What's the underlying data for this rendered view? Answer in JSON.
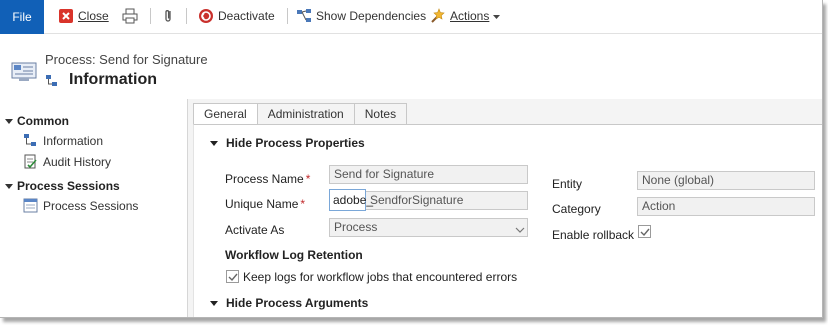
{
  "ribbon": {
    "file_label": "File",
    "close_label": "Close",
    "deactivate_label": "Deactivate",
    "show_dependencies_label": "Show Dependencies",
    "actions_label": "Actions"
  },
  "header": {
    "process_title": "Process: Send for Signature",
    "form_title": "Information"
  },
  "nav": {
    "common_label": "Common",
    "common_items": [
      {
        "label": "Information",
        "icon": "information-icon"
      },
      {
        "label": "Audit History",
        "icon": "audit-history-icon"
      }
    ],
    "process_sessions_label": "Process Sessions",
    "process_sessions_items": [
      {
        "label": "Process Sessions",
        "icon": "process-sessions-icon"
      }
    ]
  },
  "tabs": [
    {
      "label": "General",
      "active": true
    },
    {
      "label": "Administration",
      "active": false
    },
    {
      "label": "Notes",
      "active": false
    }
  ],
  "form": {
    "hide_properties_label": "Hide Process Properties",
    "process_name_label": "Process Name",
    "process_name_value": "Send for Signature",
    "unique_name_label": "Unique Name",
    "unique_name_prefix": "adobe_",
    "unique_name_value": "SendforSignature",
    "activate_as_label": "Activate As",
    "activate_as_value": "Process",
    "entity_label": "Entity",
    "entity_value": "None (global)",
    "category_label": "Category",
    "category_value": "Action",
    "enable_rollback_label": "Enable rollback",
    "enable_rollback_checked": true,
    "workflow_log_label": "Workflow Log Retention",
    "keep_logs_label": "Keep logs for workflow jobs that encountered errors",
    "keep_logs_checked": true,
    "hide_arguments_label": "Hide Process Arguments",
    "required_marker": "*"
  },
  "colors": {
    "file_button": "#1160b7",
    "required": "#c0292b",
    "panel_bg": "#f4f4f4"
  }
}
